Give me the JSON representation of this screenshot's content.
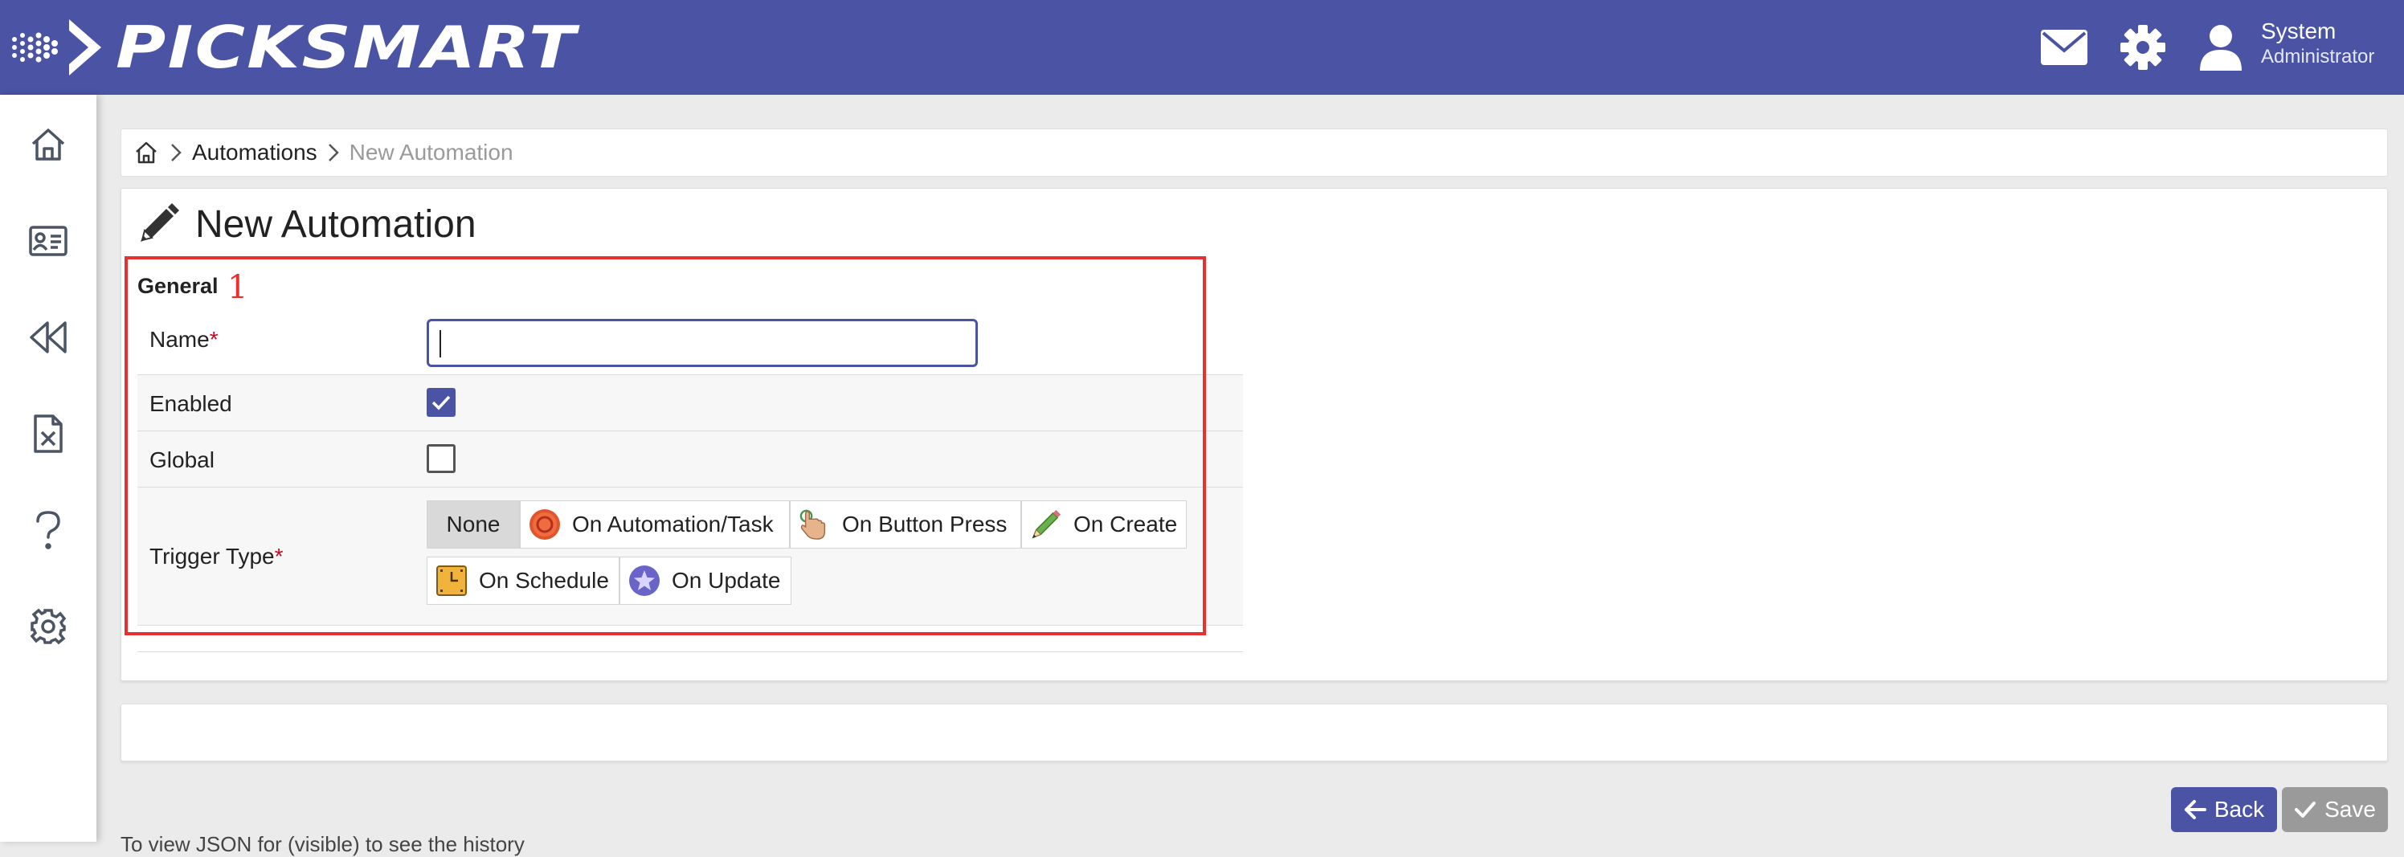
{
  "header": {
    "brand": "PICKSMART",
    "user_name": "System",
    "user_role": "Administrator"
  },
  "sidebar": {
    "items": [
      {
        "icon": "home-icon"
      },
      {
        "icon": "id-card-icon"
      },
      {
        "icon": "rewind-icon"
      },
      {
        "icon": "excel-file-icon"
      },
      {
        "icon": "help-icon"
      },
      {
        "icon": "settings-icon"
      }
    ]
  },
  "breadcrumb": {
    "items": [
      "Automations",
      "New Automation"
    ]
  },
  "page": {
    "title": "New Automation"
  },
  "annotation": {
    "number": "1",
    "color": "#e8302e"
  },
  "form": {
    "section": "General",
    "name": {
      "label": "Name",
      "required_mark": "*",
      "value": ""
    },
    "enabled": {
      "label": "Enabled",
      "checked": true
    },
    "global": {
      "label": "Global",
      "checked": false
    },
    "trigger": {
      "label": "Trigger Type",
      "required_mark": "*",
      "selected": "None",
      "options": [
        {
          "label": "None",
          "icon": ""
        },
        {
          "label": "On Automation/Task",
          "icon": "record-icon"
        },
        {
          "label": "On Button Press",
          "icon": "pointing-hand-icon"
        },
        {
          "label": "On Create",
          "icon": "pencil-icon"
        },
        {
          "label": "On Schedule",
          "icon": "schedule-icon"
        },
        {
          "label": "On Update",
          "icon": "star-icon"
        }
      ]
    }
  },
  "footer": {
    "back_label": "Back",
    "save_label": "Save",
    "cut_text": "To view JSON for (visible) to see the history"
  },
  "colors": {
    "brand": "#4a53a4",
    "required": "#d0021b",
    "save_disabled": "#9a9a9a"
  }
}
